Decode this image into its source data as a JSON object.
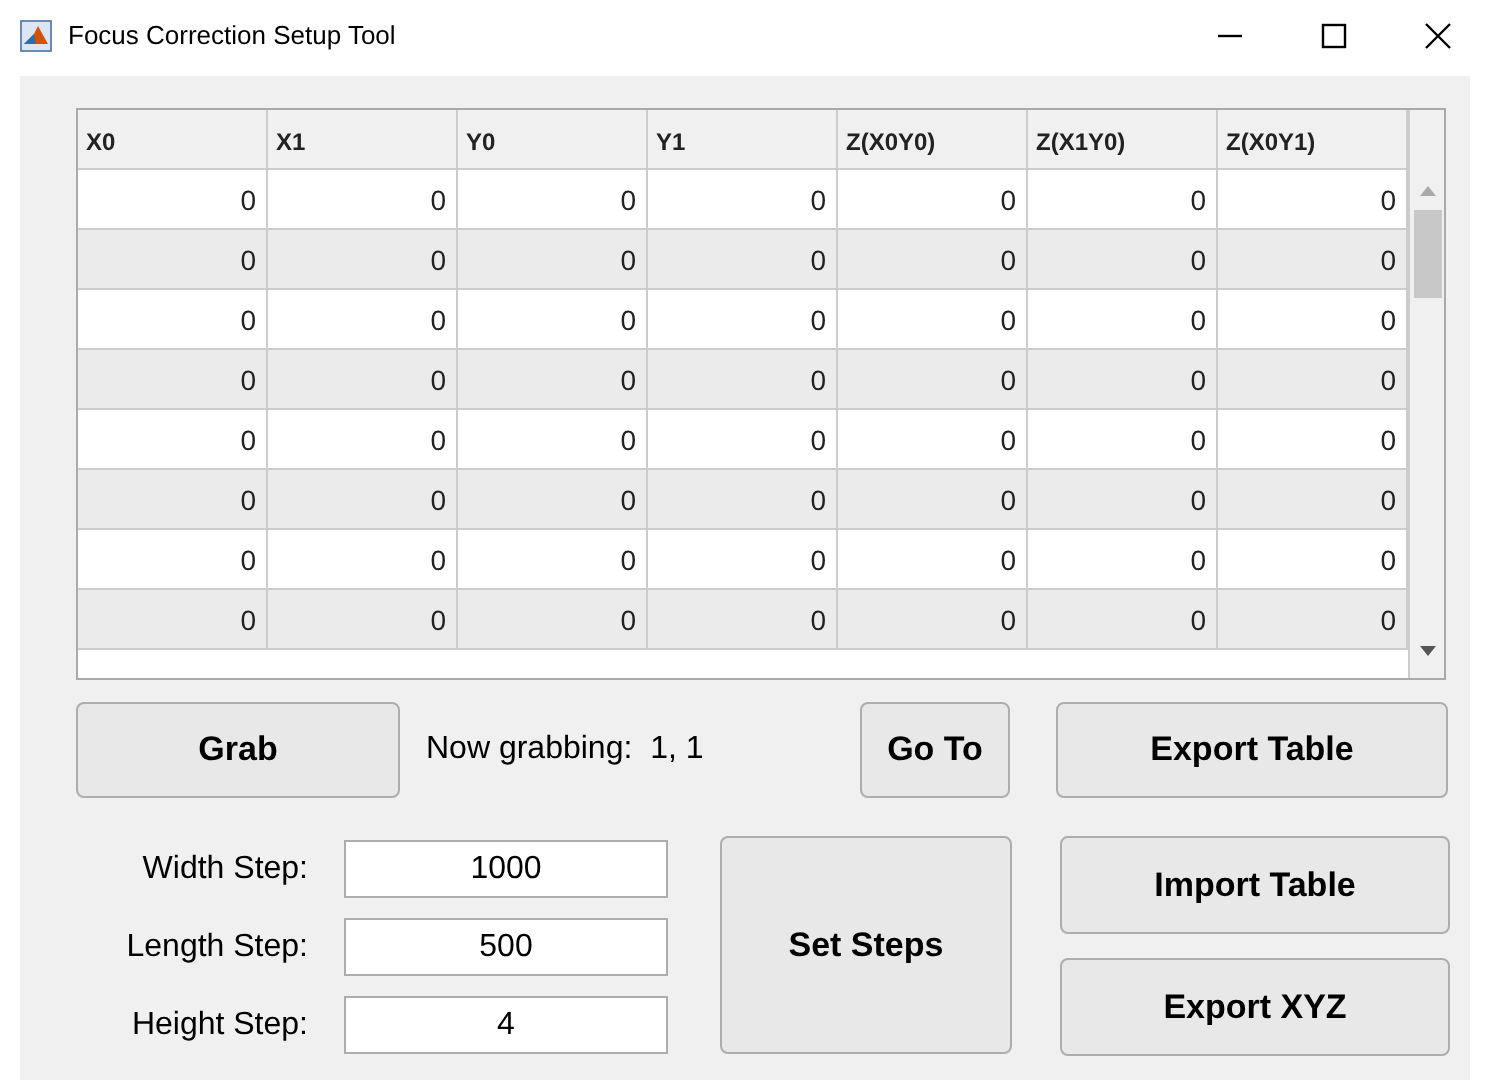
{
  "window": {
    "title": "Focus Correction Setup Tool"
  },
  "table": {
    "columns": [
      "X0",
      "X1",
      "Y0",
      "Y1",
      "Z(X0Y0)",
      "Z(X1Y0)",
      "Z(X0Y1)"
    ],
    "rows": [
      [
        "0",
        "0",
        "0",
        "0",
        "0",
        "0",
        "0"
      ],
      [
        "0",
        "0",
        "0",
        "0",
        "0",
        "0",
        "0"
      ],
      [
        "0",
        "0",
        "0",
        "0",
        "0",
        "0",
        "0"
      ],
      [
        "0",
        "0",
        "0",
        "0",
        "0",
        "0",
        "0"
      ],
      [
        "0",
        "0",
        "0",
        "0",
        "0",
        "0",
        "0"
      ],
      [
        "0",
        "0",
        "0",
        "0",
        "0",
        "0",
        "0"
      ],
      [
        "0",
        "0",
        "0",
        "0",
        "0",
        "0",
        "0"
      ],
      [
        "0",
        "0",
        "0",
        "0",
        "0",
        "0",
        "0"
      ]
    ]
  },
  "grab_button": "Grab",
  "status": "Now grabbing:  1, 1",
  "goto_button": "Go To",
  "export_table_button": "Export Table",
  "steps": [
    {
      "label": "Width Step:",
      "value": "1000"
    },
    {
      "label": "Length Step:",
      "value": "500"
    },
    {
      "label": "Height Step:",
      "value": "4"
    }
  ],
  "set_steps_button": "Set Steps",
  "import_table_button": "Import Table",
  "export_xyz_button": "Export XYZ"
}
